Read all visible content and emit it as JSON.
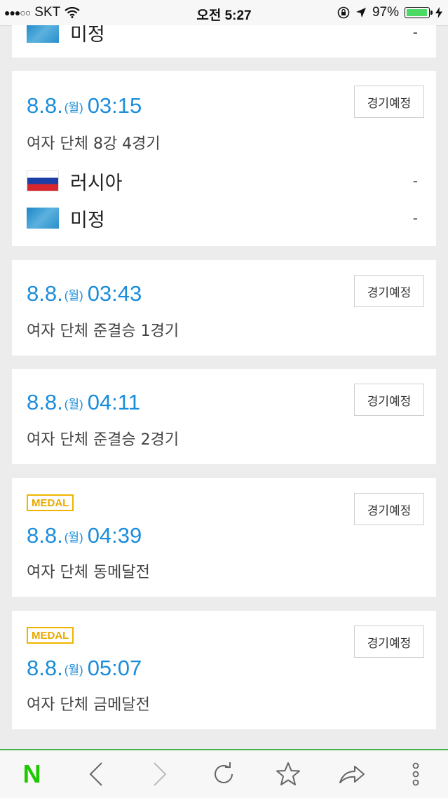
{
  "status_bar": {
    "signal": "●●●○○",
    "carrier": "SKT",
    "time": "오전 5:27",
    "battery": "97%",
    "battery_level": 0.97
  },
  "colors": {
    "accent": "#1b8ddb",
    "medal": "#f0b400",
    "naver_green": "#1ec800"
  },
  "partial_card": {
    "team_name": "미정",
    "score": "-"
  },
  "matches": [
    {
      "date_md": "8.8.",
      "dow": "(월)",
      "time": "03:15",
      "title": "여자 단체 8강 4경기",
      "status": "경기예정",
      "teams": [
        {
          "name": "러시아",
          "score": "-",
          "flag": "flag-russia"
        },
        {
          "name": "미정",
          "score": "-",
          "flag": "flag-undecided"
        }
      ]
    },
    {
      "date_md": "8.8.",
      "dow": "(월)",
      "time": "03:43",
      "title": "여자 단체 준결승 1경기",
      "status": "경기예정"
    },
    {
      "date_md": "8.8.",
      "dow": "(월)",
      "time": "04:11",
      "title": "여자 단체 준결승 2경기",
      "status": "경기예정"
    },
    {
      "medal": "MEDAL",
      "date_md": "8.8.",
      "dow": "(월)",
      "time": "04:39",
      "title": "여자 단체 동메달전",
      "status": "경기예정"
    },
    {
      "medal": "MEDAL",
      "date_md": "8.8.",
      "dow": "(월)",
      "time": "05:07",
      "title": "여자 단체 금메달전",
      "status": "경기예정"
    }
  ],
  "toolbar": {
    "logo": "N",
    "icons": [
      "naver-logo",
      "back-icon",
      "forward-icon",
      "refresh-icon",
      "star-icon",
      "share-icon",
      "more-icon"
    ]
  }
}
